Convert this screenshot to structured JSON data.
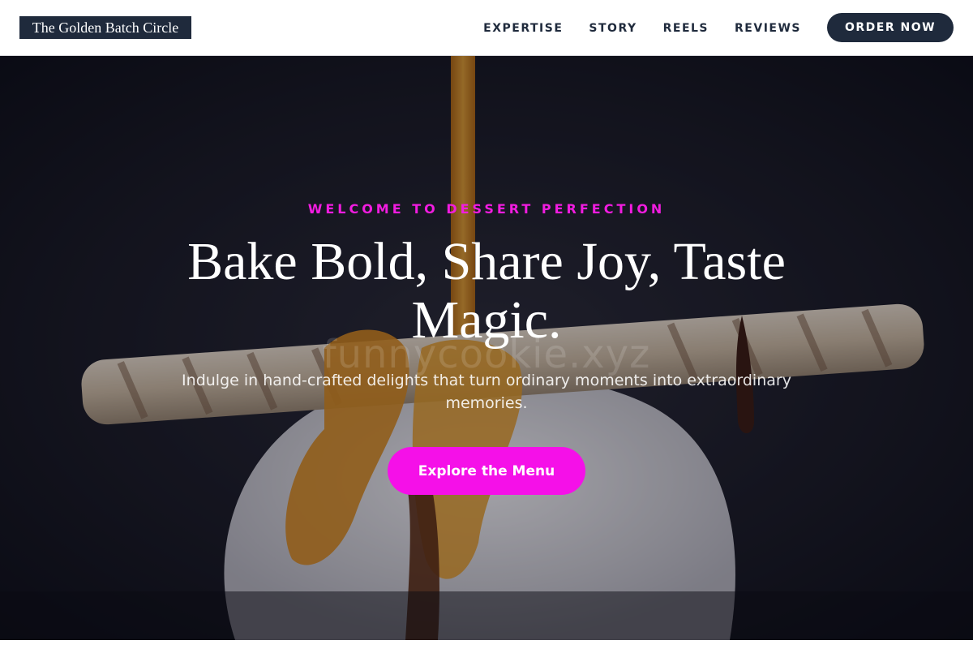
{
  "header": {
    "brand": "The Golden Batch Circle",
    "nav": [
      {
        "label": "EXPERTISE"
      },
      {
        "label": "STORY"
      },
      {
        "label": "REELS"
      },
      {
        "label": "REVIEWS"
      }
    ],
    "order_label": "ORDER NOW"
  },
  "hero": {
    "eyebrow": "WELCOME TO DESSERT PERFECTION",
    "headline": "Bake Bold, Share Joy, Taste Magic.",
    "subhead": "Indulge in hand-crafted delights that turn ordinary moments into extraordinary memories.",
    "cta_label": "Explore the Menu",
    "watermark": "funnycookie.xyz"
  },
  "colors": {
    "navy": "#1f2a3c",
    "accent_magenta": "#f510e8"
  }
}
